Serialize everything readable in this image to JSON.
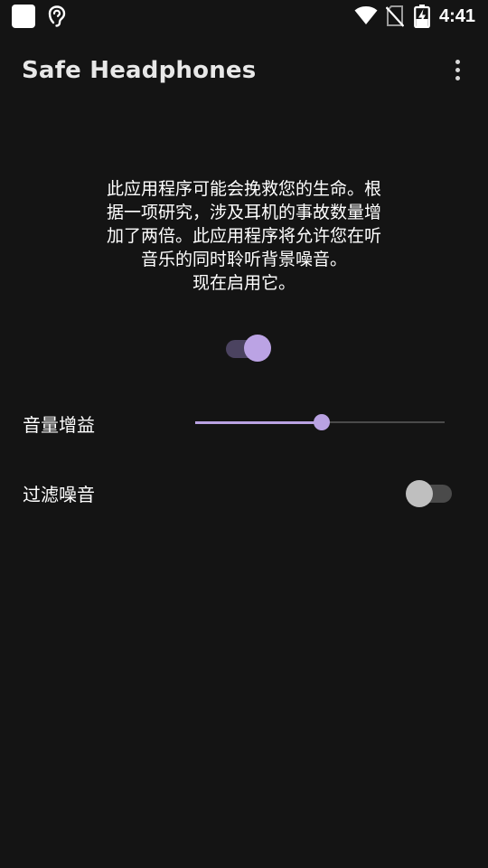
{
  "status_bar": {
    "time": "4:41",
    "icons": [
      "app-notification-icon",
      "hearing-icon",
      "wifi-icon",
      "no-sim-icon",
      "battery-charging-icon"
    ]
  },
  "app_bar": {
    "title": "Safe Headphones",
    "menu_icon": "more-vert-icon"
  },
  "description": {
    "lines": [
      "此应用程序可能会挽救您的生命。根",
      "据一项研究，涉及耳机的事故数量增",
      "加了两倍。此应用程序将允许您在听",
      "音乐的同时聆听背景噪音。",
      "现在启用它。"
    ]
  },
  "main_switch": {
    "on": true
  },
  "volume_gain": {
    "label": "音量增益",
    "value_fraction": 0.5
  },
  "noise_filter": {
    "label": "过滤噪音",
    "on": false
  },
  "colors": {
    "background": "#141414",
    "accent": "#b9a2e2",
    "accent_track": "#4b4360",
    "off_track": "#4a4a4a",
    "off_thumb": "#bfbfbf"
  }
}
